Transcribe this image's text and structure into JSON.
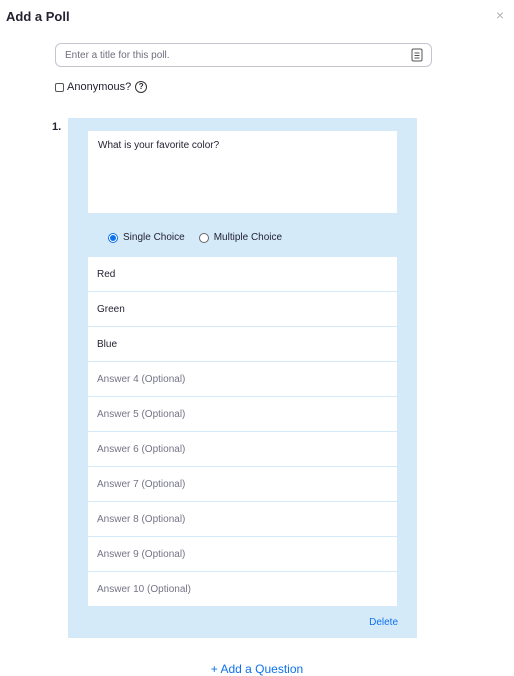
{
  "dialog": {
    "title": "Add a Poll",
    "close_label": "×"
  },
  "poll_title": {
    "placeholder": "Enter a title for this poll.",
    "value": ""
  },
  "anonymous": {
    "label": "Anonymous?",
    "checked": false,
    "help_glyph": "?"
  },
  "question": {
    "number": "1.",
    "text": "What is your favorite color?",
    "choice_types": [
      {
        "label": "Single Choice",
        "selected": true
      },
      {
        "label": "Multiple Choice",
        "selected": false
      }
    ],
    "answers": [
      {
        "text": "Red",
        "is_placeholder": false
      },
      {
        "text": "Green",
        "is_placeholder": false
      },
      {
        "text": "Blue",
        "is_placeholder": false
      },
      {
        "text": "Answer 4 (Optional)",
        "is_placeholder": true
      },
      {
        "text": "Answer 5 (Optional)",
        "is_placeholder": true
      },
      {
        "text": "Answer 6 (Optional)",
        "is_placeholder": true
      },
      {
        "text": "Answer 7 (Optional)",
        "is_placeholder": true
      },
      {
        "text": "Answer 8 (Optional)",
        "is_placeholder": true
      },
      {
        "text": "Answer 9 (Optional)",
        "is_placeholder": true
      },
      {
        "text": "Answer 10 (Optional)",
        "is_placeholder": true
      }
    ],
    "delete_label": "Delete"
  },
  "add_question_label": "+ Add a Question",
  "colors": {
    "accent": "#0e72ed",
    "panel_bg": "#d5eaf9",
    "placeholder_text": "#747487"
  },
  "icons": {
    "close": "close-icon",
    "title_field": "document-icon",
    "help": "help-circle-icon"
  }
}
